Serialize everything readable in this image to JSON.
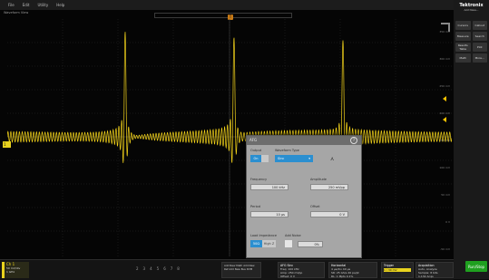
{
  "menu": [
    "File",
    "Edit",
    "Utility",
    "Help"
  ],
  "waveform_view_title": "Waveform View",
  "trigger_position_marker": "T",
  "channel_marker": "1",
  "y_axis_labels": [
    "350 mV",
    "300 mV",
    "250 mV",
    "200 mV",
    "150 mV",
    "100 mV",
    "50 mV",
    "0 V",
    "-50 mV",
    "-100 mV"
  ],
  "right_panel": {
    "brand": "Tektronix",
    "add_new": "Add New...",
    "buttons": [
      "Cursors",
      "Callout",
      "Measure",
      "Search",
      "Results Table",
      "Plot",
      "Math",
      "More..."
    ]
  },
  "dialog": {
    "title": "AFG",
    "help": "?",
    "output_label": "Output",
    "output_on": "On",
    "waveform_type_label": "Waveform Type",
    "waveform_type_value": "Sinc",
    "frequency_label": "Frequency",
    "frequency_value": "100 kHz",
    "amplitude_label": "Amplitude",
    "amplitude_value": "250 mVpp",
    "period_label": "Period",
    "period_value": "10 µs",
    "offset_label": "Offset",
    "offset_value": "0 V",
    "load_impedance_label": "Load Impedance",
    "load_50": "50Ω",
    "load_high": "High Z",
    "add_noise_label": "Add Noise",
    "add_noise_value": "0%"
  },
  "bottom": {
    "ch1_title": "Ch 1",
    "ch1_line1": "50 mV/div",
    "ch1_line2": "1 GHz",
    "channel_buttons": [
      "2",
      "3",
      "4",
      "5",
      "6",
      "7",
      "8"
    ],
    "extras": [
      "Add New Math",
      "Add New Ref",
      "Add New Bus",
      "DVM"
    ],
    "afg_title": "AFG Sinc",
    "afg_line1": "Freq: 100 kHz",
    "afg_line2": "Amp: 250 mVpp",
    "afg_line3": "Offset: 0 V",
    "horizontal_title": "Horizontal",
    "horizontal_line1": "4 µs/div   40 µs",
    "horizontal_line2": "SR: 25 GS/s  40 ps/pt",
    "horizontal_line3": "RL: 1 Mpts  0.1%",
    "trigger_title": "Trigger",
    "trigger_value": "1  /  30 mV",
    "acquisition_title": "Acquisition",
    "acquisition_line1": "Auto,  Analyze",
    "acquisition_line2": "Sample: 8 bits",
    "acquisition_line3": "1,132 Acqs",
    "run_button": "Run/Stop"
  },
  "colors": {
    "trace": "#f2d21a",
    "accent": "#2b8fd0",
    "run": "#1fa01f"
  }
}
